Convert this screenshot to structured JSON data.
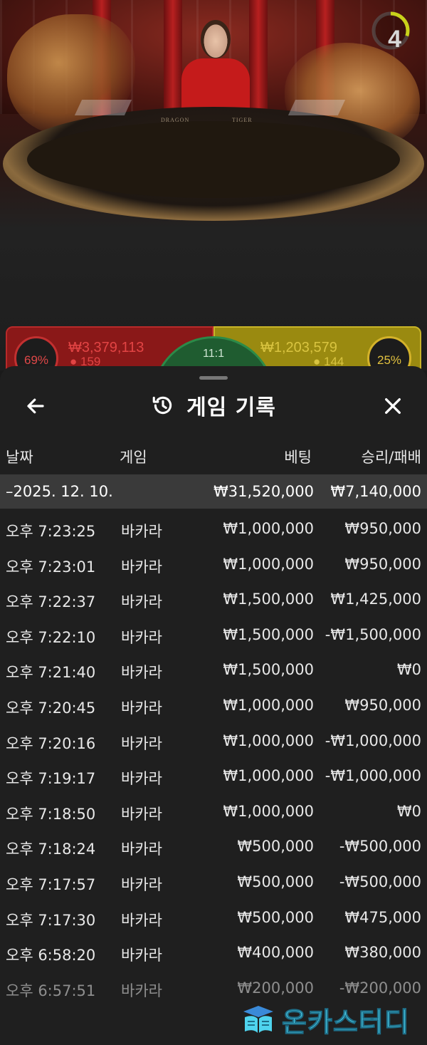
{
  "live_table": {
    "timer_value": "4",
    "timer_progress": 0.3,
    "left_spot": {
      "percent": "69%",
      "amount": "₩3,379,113",
      "users": "159"
    },
    "right_spot": {
      "percent": "25%",
      "amount": "₩1,203,579",
      "users": "144"
    },
    "tie_spot": {
      "payout": "11:1"
    },
    "table_text": {
      "left": "DRAGON",
      "right": "TIGER"
    }
  },
  "sheet": {
    "title": "게임 기록",
    "icons": {
      "back": "arrow-left-icon",
      "history": "history-icon",
      "close": "close-icon"
    },
    "columns": {
      "date": "날짜",
      "game": "게임",
      "bet": "베팅",
      "win_loss": "승리/패배"
    },
    "summary": {
      "date": "–2025. 12. 10.",
      "bet": "₩31,520,000",
      "win_loss": "₩7,140,000"
    },
    "rows": [
      {
        "time": "오후 7:23:25",
        "game": "바카라",
        "bet": "₩1,000,000",
        "win_loss": "₩950,000"
      },
      {
        "time": "오후 7:23:01",
        "game": "바카라",
        "bet": "₩1,000,000",
        "win_loss": "₩950,000"
      },
      {
        "time": "오후 7:22:37",
        "game": "바카라",
        "bet": "₩1,500,000",
        "win_loss": "₩1,425,000"
      },
      {
        "time": "오후 7:22:10",
        "game": "바카라",
        "bet": "₩1,500,000",
        "win_loss": "-₩1,500,000"
      },
      {
        "time": "오후 7:21:40",
        "game": "바카라",
        "bet": "₩1,500,000",
        "win_loss": "₩0"
      },
      {
        "time": "오후 7:20:45",
        "game": "바카라",
        "bet": "₩1,000,000",
        "win_loss": "₩950,000"
      },
      {
        "time": "오후 7:20:16",
        "game": "바카라",
        "bet": "₩1,000,000",
        "win_loss": "-₩1,000,000"
      },
      {
        "time": "오후 7:19:17",
        "game": "바카라",
        "bet": "₩1,000,000",
        "win_loss": "-₩1,000,000"
      },
      {
        "time": "오후 7:18:50",
        "game": "바카라",
        "bet": "₩1,000,000",
        "win_loss": "₩0"
      },
      {
        "time": "오후 7:18:24",
        "game": "바카라",
        "bet": "₩500,000",
        "win_loss": "-₩500,000"
      },
      {
        "time": "오후 7:17:57",
        "game": "바카라",
        "bet": "₩500,000",
        "win_loss": "-₩500,000"
      },
      {
        "time": "오후 7:17:30",
        "game": "바카라",
        "bet": "₩500,000",
        "win_loss": "₩475,000"
      },
      {
        "time": "오후 6:58:20",
        "game": "바카라",
        "bet": "₩400,000",
        "win_loss": "₩380,000"
      },
      {
        "time": "오후 6:57:51",
        "game": "바카라",
        "bet": "₩200,000",
        "win_loss": "-₩200,000"
      }
    ]
  },
  "watermark": {
    "text": "온카스터디",
    "icon": "book-icon",
    "color": "#4fd4ee"
  }
}
